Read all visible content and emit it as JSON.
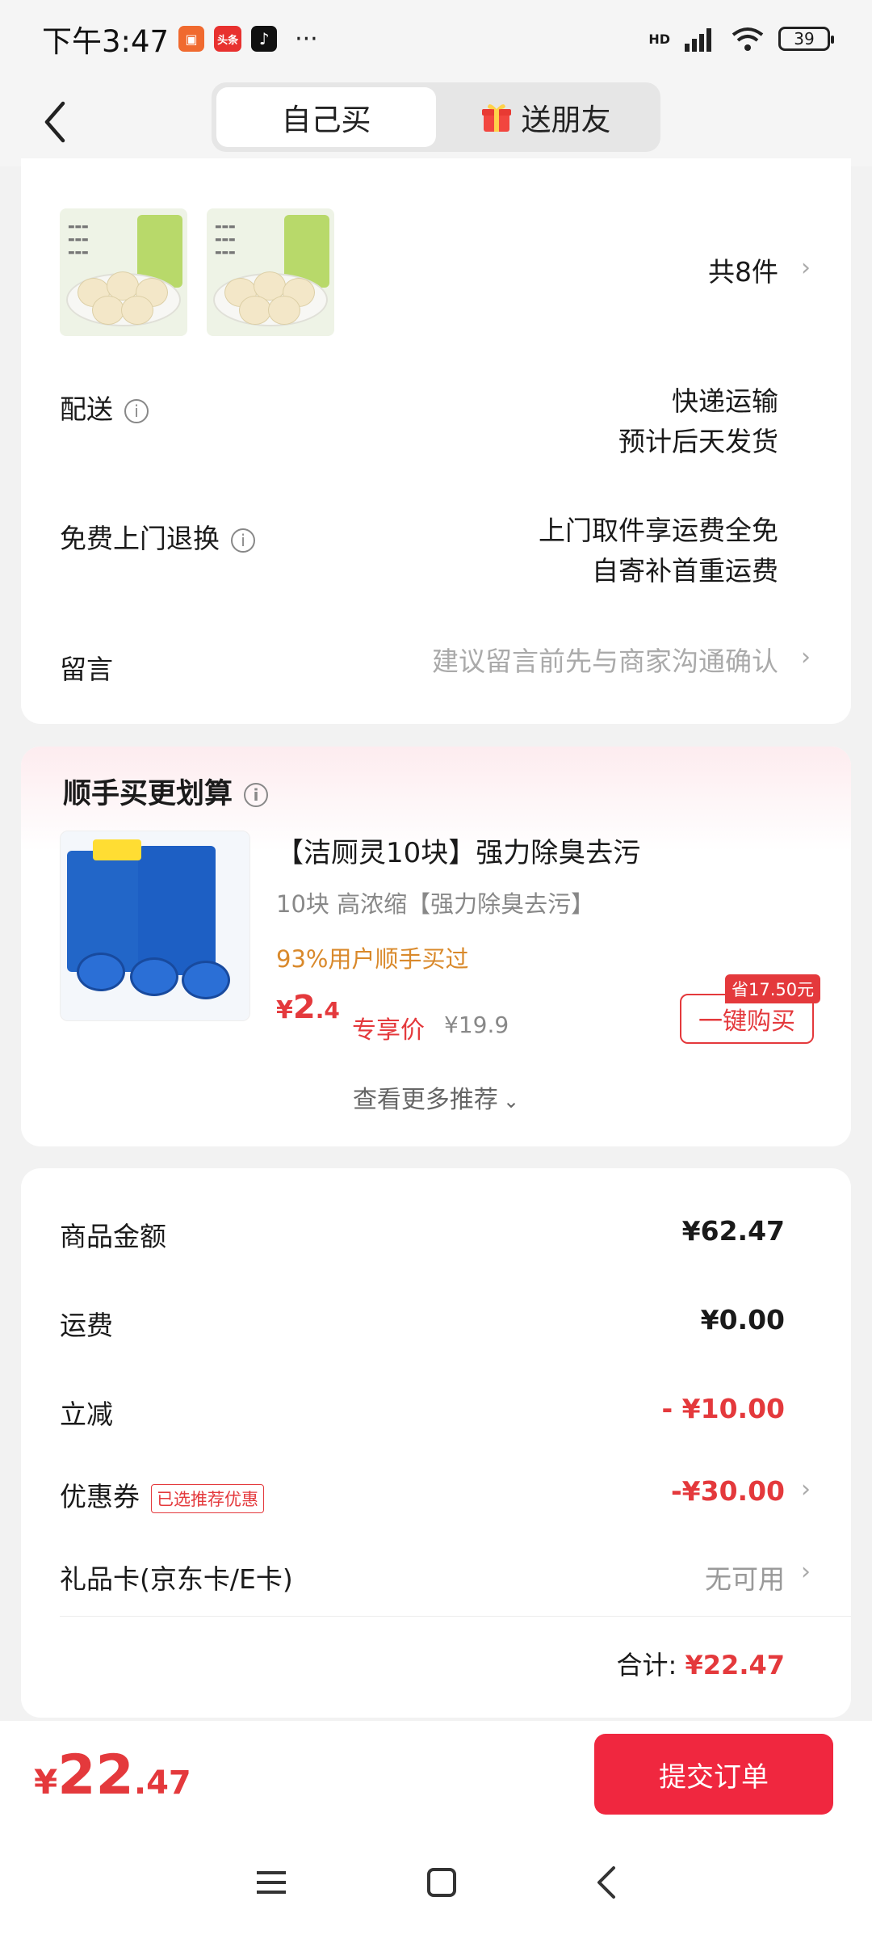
{
  "status_bar": {
    "time": "下午3:47",
    "app_toutiao": "头条",
    "more": "···",
    "signal": "HD",
    "battery": "39"
  },
  "nav": {
    "tab_self": "自己买",
    "tab_gift": "送朋友"
  },
  "order": {
    "count_text": "共8件",
    "delivery_label": "配送",
    "delivery_line1": "快递运输",
    "delivery_line2": "预计后天发货",
    "return_label": "免费上门退换",
    "return_line1": "上门取件享运费全免",
    "return_line2": "自寄补首重运费",
    "message_label": "留言",
    "message_placeholder": "建议留言前先与商家沟通确认"
  },
  "recommend": {
    "title": "顺手买更划算",
    "product_title": "【洁厕灵10块】强力除臭去污",
    "product_subtitle": "10块 高浓缩【强力除臭去污】",
    "product_note": "93%用户顺手买过",
    "price_symbol": "¥",
    "price_int": "2",
    "price_dec": ".4",
    "price_tag": "专享价",
    "original_price": "¥19.9",
    "save_badge": "省17.50元",
    "buy_button": "一键购买",
    "more_link": "查看更多推荐"
  },
  "summary": {
    "goods_label": "商品金额",
    "goods_value": "¥62.47",
    "shipping_label": "运费",
    "shipping_value": "¥0.00",
    "discount_label": "立减",
    "discount_value": "- ¥10.00",
    "coupon_label": "优惠券",
    "coupon_badge": "已选推荐优惠",
    "coupon_value": "-¥30.00",
    "giftcard_label": "礼品卡(京东卡/E卡)",
    "giftcard_value": "无可用",
    "total_label": "合计:",
    "total_value": "¥22.47"
  },
  "bottom": {
    "price_symbol": "¥",
    "price_int": "22",
    "price_dec": ".47",
    "submit_label": "提交订单"
  },
  "colors": {
    "accent_red": "#e4393c",
    "submit_red": "#f0273f",
    "note_orange": "#d9892b"
  }
}
